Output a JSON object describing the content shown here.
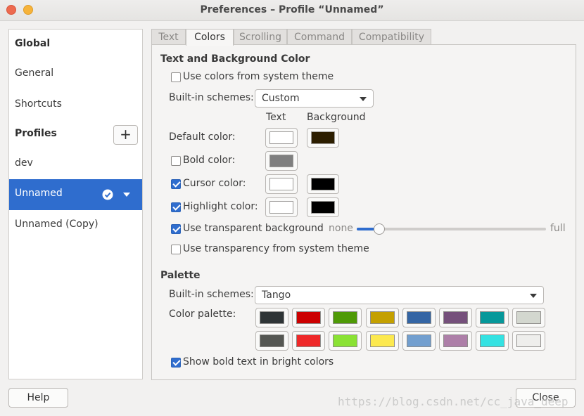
{
  "window": {
    "title": "Preferences – Profile “Unnamed”"
  },
  "sidebar": {
    "global_header": "Global",
    "items": [
      "General",
      "Shortcuts"
    ],
    "profiles_header": "Profiles",
    "add_label": "+",
    "profiles": [
      "dev",
      "Unnamed",
      "Unnamed (Copy)"
    ],
    "selected_profile": "Unnamed"
  },
  "tabs": [
    {
      "label": "Text"
    },
    {
      "label": "Colors"
    },
    {
      "label": "Scrolling"
    },
    {
      "label": "Command"
    },
    {
      "label": "Compatibility"
    }
  ],
  "active_tab": "Colors",
  "colors": {
    "section_title": "Text and Background Color",
    "use_system_colors": {
      "label": "Use colors from system theme",
      "checked": false
    },
    "builtin_label": "Built-in schemes:",
    "builtin_value": "Custom",
    "col_text": "Text",
    "col_background": "Background",
    "default_label": "Default color:",
    "default_text": "#ffffff",
    "default_bg": "#2c1e00",
    "bold": {
      "label": "Bold color:",
      "checked": false,
      "text": "#7f7f7f"
    },
    "cursor": {
      "label": "Cursor color:",
      "checked": true,
      "text": "#ffffff",
      "bg": "#000000"
    },
    "highlight": {
      "label": "Highlight color:",
      "checked": true,
      "text": "#ffffff",
      "bg": "#000000"
    },
    "transparent_bg": {
      "label": "Use transparent background",
      "checked": true
    },
    "slider": {
      "min_label": "none",
      "max_label": "full",
      "value": 0.12
    },
    "transparency_system": {
      "label": "Use transparency from system theme",
      "checked": false
    }
  },
  "palette": {
    "section_title": "Palette",
    "builtin_label": "Built-in schemes:",
    "builtin_value": "Tango",
    "palette_label": "Color palette:",
    "row1": [
      "#2e3436",
      "#cc0000",
      "#4e9a06",
      "#c4a000",
      "#3465a4",
      "#75507b",
      "#06989a",
      "#d3d7cf"
    ],
    "row2": [
      "#555753",
      "#ef2929",
      "#8ae234",
      "#fce94f",
      "#729fcf",
      "#ad7fa8",
      "#34e2e2",
      "#eeeeec"
    ],
    "bright_bold": {
      "label": "Show bold text in bright colors",
      "checked": true
    }
  },
  "buttons": {
    "help": "Help",
    "close": "Close"
  },
  "watermark": "https://blog.csdn.net/cc_java_deep"
}
